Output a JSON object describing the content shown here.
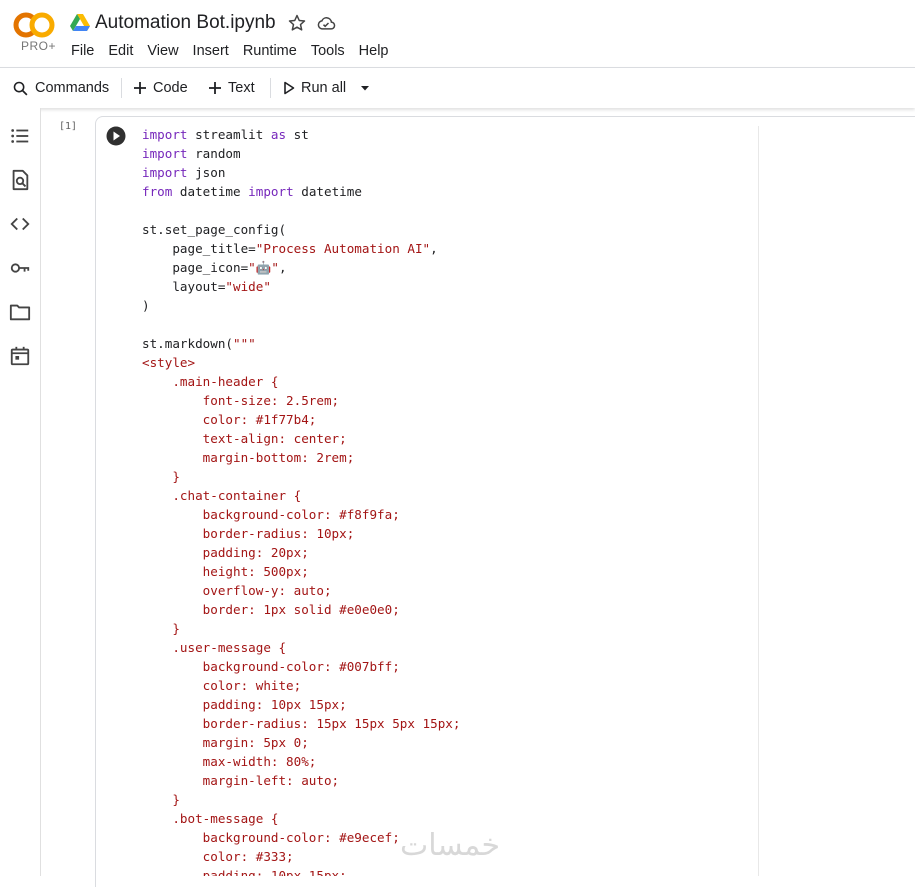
{
  "app": {
    "logo_text": "CO",
    "plan_badge": "PRO+",
    "notebook_title": "Automation Bot.ipynb"
  },
  "menu": [
    "File",
    "Edit",
    "View",
    "Insert",
    "Runtime",
    "Tools",
    "Help"
  ],
  "toolbar": {
    "commands_label": "Commands",
    "code_label": "Code",
    "text_label": "Text",
    "run_all_label": "Run all"
  },
  "sidebar": {
    "icons": [
      "table-of-contents-icon",
      "find-replace-icon",
      "code-snippets-icon",
      "secrets-key-icon",
      "files-folder-icon",
      "calendar-icon"
    ]
  },
  "cell": {
    "execution_count": "[1]",
    "lines": [
      [
        {
          "t": "import",
          "c": "kw"
        },
        {
          "t": " streamlit "
        },
        {
          "t": "as",
          "c": "kw"
        },
        {
          "t": " st"
        }
      ],
      [
        {
          "t": "import",
          "c": "kw"
        },
        {
          "t": " random"
        }
      ],
      [
        {
          "t": "import",
          "c": "kw"
        },
        {
          "t": " json"
        }
      ],
      [
        {
          "t": "from",
          "c": "kw"
        },
        {
          "t": " datetime "
        },
        {
          "t": "import",
          "c": "kw"
        },
        {
          "t": " datetime"
        }
      ],
      [],
      [
        {
          "t": "st.set_page_config("
        }
      ],
      [
        {
          "t": "    page_title="
        },
        {
          "t": "\"Process Automation AI\"",
          "c": "str"
        },
        {
          "t": ","
        }
      ],
      [
        {
          "t": "    page_icon="
        },
        {
          "t": "\"🤖\"",
          "c": "str"
        },
        {
          "t": ","
        }
      ],
      [
        {
          "t": "    layout="
        },
        {
          "t": "\"wide\"",
          "c": "str"
        }
      ],
      [
        {
          "t": ")"
        }
      ],
      [],
      [
        {
          "t": "st.markdown("
        },
        {
          "t": "\"\"\"",
          "c": "str"
        }
      ],
      [
        {
          "t": "<style>",
          "c": "str"
        }
      ],
      [
        {
          "t": "    .main-header {",
          "c": "str"
        }
      ],
      [
        {
          "t": "        font-size: 2.5rem;",
          "c": "str"
        }
      ],
      [
        {
          "t": "        color: #1f77b4;",
          "c": "str"
        }
      ],
      [
        {
          "t": "        text-align: center;",
          "c": "str"
        }
      ],
      [
        {
          "t": "        margin-bottom: 2rem;",
          "c": "str"
        }
      ],
      [
        {
          "t": "    }",
          "c": "str"
        }
      ],
      [
        {
          "t": "    .chat-container {",
          "c": "str"
        }
      ],
      [
        {
          "t": "        background-color: #f8f9fa;",
          "c": "str"
        }
      ],
      [
        {
          "t": "        border-radius: 10px;",
          "c": "str"
        }
      ],
      [
        {
          "t": "        padding: 20px;",
          "c": "str"
        }
      ],
      [
        {
          "t": "        height: 500px;",
          "c": "str"
        }
      ],
      [
        {
          "t": "        overflow-y: auto;",
          "c": "str"
        }
      ],
      [
        {
          "t": "        border: 1px solid #e0e0e0;",
          "c": "str"
        }
      ],
      [
        {
          "t": "    }",
          "c": "str"
        }
      ],
      [
        {
          "t": "    .user-message {",
          "c": "str"
        }
      ],
      [
        {
          "t": "        background-color: #007bff;",
          "c": "str"
        }
      ],
      [
        {
          "t": "        color: white;",
          "c": "str"
        }
      ],
      [
        {
          "t": "        padding: 10px 15px;",
          "c": "str"
        }
      ],
      [
        {
          "t": "        border-radius: 15px 15px 5px 15px;",
          "c": "str"
        }
      ],
      [
        {
          "t": "        margin: 5px 0;",
          "c": "str"
        }
      ],
      [
        {
          "t": "        max-width: 80%;",
          "c": "str"
        }
      ],
      [
        {
          "t": "        margin-left: auto;",
          "c": "str"
        }
      ],
      [
        {
          "t": "    }",
          "c": "str"
        }
      ],
      [
        {
          "t": "    .bot-message {",
          "c": "str"
        }
      ],
      [
        {
          "t": "        background-color: #e9ecef;",
          "c": "str"
        }
      ],
      [
        {
          "t": "        color: #333;",
          "c": "str"
        }
      ],
      [
        {
          "t": "        padding: 10px 15px;",
          "c": "str"
        }
      ]
    ]
  },
  "watermark": "خمسات",
  "colors": {
    "keyword": "#7627bb",
    "string": "#a31515",
    "logo_orange": "#f9ab00",
    "logo_dark_orange": "#e37400"
  }
}
